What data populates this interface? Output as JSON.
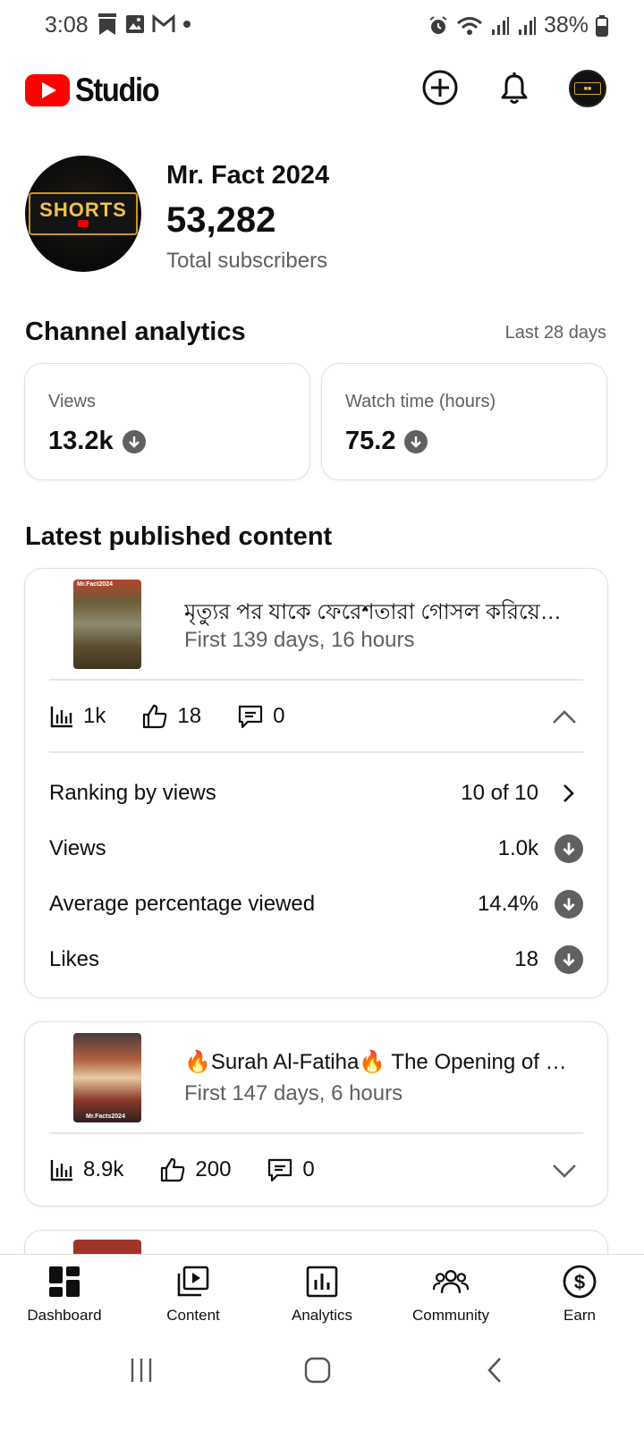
{
  "status_bar": {
    "time": "3:08",
    "battery": "38%",
    "icons": [
      "bookmark-icon",
      "image-icon",
      "gmail-icon",
      "dot-icon",
      "alarm-icon",
      "wifi-icon",
      "signal-icon",
      "signal-icon",
      "battery-icon"
    ]
  },
  "app_bar": {
    "logo_text": "Studio",
    "brand_color": "#ff0000",
    "icons": [
      "create-icon",
      "notifications-icon",
      "account-avatar"
    ]
  },
  "channel": {
    "name": "Mr. Fact 2024",
    "subscribers": "53,282",
    "subscribers_label": "Total subscribers",
    "avatar_text": "SHORTS"
  },
  "analytics": {
    "title": "Channel analytics",
    "period": "Last 28 days",
    "metrics": [
      {
        "label": "Views",
        "value": "13.2k",
        "trend": "down"
      },
      {
        "label": "Watch time (hours)",
        "value": "75.2",
        "trend": "down"
      }
    ]
  },
  "latest": {
    "title": "Latest published content",
    "items": [
      {
        "title": "মৃত্যুর পর যাকে ফেরেশতারা গোসল করিয়ে…",
        "subtitle": "First 139 days, 16 hours",
        "thumb_tag": "Mr.Fact2024",
        "views": "1k",
        "likes": "18",
        "comments": "0",
        "expanded": true,
        "details": [
          {
            "label": "Ranking by views",
            "value": "10 of 10",
            "icon": "chevron-right-icon"
          },
          {
            "label": "Views",
            "value": "1.0k",
            "icon": "trend-down-icon"
          },
          {
            "label": "Average percentage viewed",
            "value": "14.4%",
            "icon": "trend-down-icon"
          },
          {
            "label": "Likes",
            "value": "18",
            "icon": "trend-down-icon"
          }
        ]
      },
      {
        "title": "🔥Surah Al-Fatiha🔥 The Opening of Fa…",
        "subtitle": "First 147 days, 6 hours",
        "thumb_tag": "Mr.Facts2024",
        "views": "8.9k",
        "likes": "200",
        "comments": "0",
        "expanded": false
      }
    ]
  },
  "bottom_nav": {
    "items": [
      {
        "label": "Dashboard",
        "icon": "dashboard-icon",
        "active": true
      },
      {
        "label": "Content",
        "icon": "content-icon",
        "active": false
      },
      {
        "label": "Analytics",
        "icon": "analytics-icon",
        "active": false
      },
      {
        "label": "Community",
        "icon": "community-icon",
        "active": false
      },
      {
        "label": "Earn",
        "icon": "earn-icon",
        "active": false
      }
    ]
  }
}
